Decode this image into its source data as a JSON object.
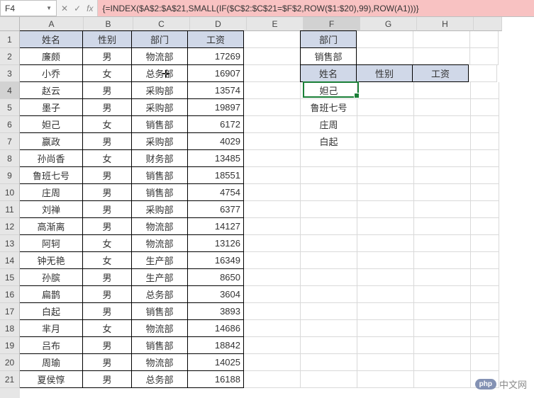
{
  "namebox": "F4",
  "formula": "{=INDEX($A$2:$A$21,SMALL(IF($C$2:$C$21=$F$2,ROW($1:$20),99),ROW(A1)))}",
  "columns": [
    "A",
    "B",
    "C",
    "D",
    "E",
    "F",
    "G",
    "H"
  ],
  "rows_count": 21,
  "active": {
    "row": 4,
    "col": "F"
  },
  "main_headers": [
    "姓名",
    "性别",
    "部门",
    "工资"
  ],
  "main_data": [
    {
      "name": "廉颇",
      "gender": "男",
      "dept": "物流部",
      "salary": 17269
    },
    {
      "name": "小乔",
      "gender": "女",
      "dept": "总务部",
      "salary": 16907
    },
    {
      "name": "赵云",
      "gender": "男",
      "dept": "采购部",
      "salary": 13574
    },
    {
      "name": "墨子",
      "gender": "男",
      "dept": "采购部",
      "salary": 19897
    },
    {
      "name": "妲己",
      "gender": "女",
      "dept": "销售部",
      "salary": 6172
    },
    {
      "name": "嬴政",
      "gender": "男",
      "dept": "采购部",
      "salary": 4029
    },
    {
      "name": "孙尚香",
      "gender": "女",
      "dept": "财务部",
      "salary": 13485
    },
    {
      "name": "鲁班七号",
      "gender": "男",
      "dept": "销售部",
      "salary": 18551
    },
    {
      "name": "庄周",
      "gender": "男",
      "dept": "销售部",
      "salary": 4754
    },
    {
      "name": "刘禅",
      "gender": "男",
      "dept": "采购部",
      "salary": 6377
    },
    {
      "name": "高渐离",
      "gender": "男",
      "dept": "物流部",
      "salary": 14127
    },
    {
      "name": "阿轲",
      "gender": "女",
      "dept": "物流部",
      "salary": 13126
    },
    {
      "name": "钟无艳",
      "gender": "女",
      "dept": "生产部",
      "salary": 16349
    },
    {
      "name": "孙膑",
      "gender": "男",
      "dept": "生产部",
      "salary": 8650
    },
    {
      "name": "扁鹊",
      "gender": "男",
      "dept": "总务部",
      "salary": 3604
    },
    {
      "name": "白起",
      "gender": "男",
      "dept": "销售部",
      "salary": 3893
    },
    {
      "name": "芈月",
      "gender": "女",
      "dept": "物流部",
      "salary": 14686
    },
    {
      "name": "吕布",
      "gender": "男",
      "dept": "销售部",
      "salary": 18842
    },
    {
      "name": "周瑜",
      "gender": "男",
      "dept": "物流部",
      "salary": 14025
    },
    {
      "name": "夏侯惇",
      "gender": "男",
      "dept": "总务部",
      "salary": 16188
    }
  ],
  "side": {
    "f1": "部门",
    "f2": "销售部",
    "f3": "姓名",
    "g3": "性别",
    "h3": "工资",
    "results": [
      "妲己",
      "鲁班七号",
      "庄周",
      "白起"
    ]
  },
  "watermark": {
    "logo": "php",
    "text": "中文网"
  },
  "fb_buttons": {
    "cancel": "✕",
    "enter": "✓",
    "fx": "fx"
  }
}
